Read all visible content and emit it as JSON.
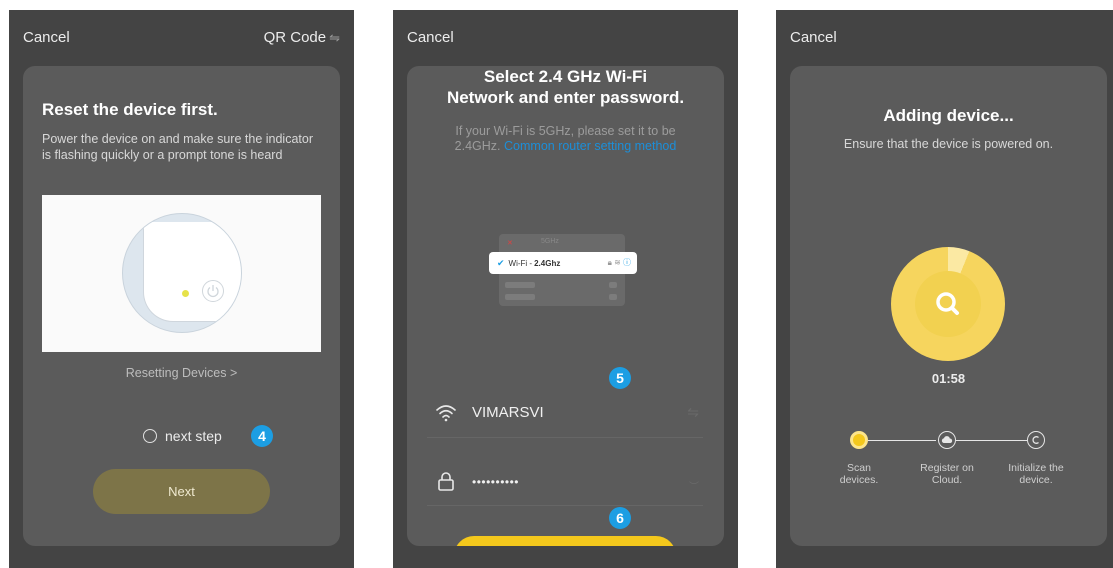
{
  "screens": [
    {
      "top_left": "Cancel",
      "top_right": "QR Code",
      "title": "Reset the device first.",
      "description": "Power the device on and make sure the indicator is flashing quickly or a prompt tone is heard",
      "help_link": "Resetting Devices >",
      "checkbox_label": "next step",
      "badge": "4",
      "button_label": "Next"
    },
    {
      "top_left": "Cancel",
      "title_line1": "Select 2.4 GHz Wi-Fi",
      "title_line2": "Network and enter password.",
      "description": "If your Wi-Fi is 5GHz, please set it to be 2.4GHz.",
      "description_link": "Common router setting method",
      "illus_5g": "5GHz",
      "illus_wifi_label": "Wi-Fi -",
      "illus_wifi_band": "2.4Ghz",
      "badge_top": "5",
      "badge_bottom": "6",
      "network_name": "VIMARSVI",
      "password_mask": "••••••••••"
    },
    {
      "top_left": "Cancel",
      "title": "Adding device...",
      "description": "Ensure that the device is powered on.",
      "timer": "01:58",
      "progress_fraction": 0.06,
      "steps": [
        {
          "line1": "Scan",
          "line2": "devices."
        },
        {
          "line1": "Register on",
          "line2": "Cloud."
        },
        {
          "line1": "Initialize the",
          "line2": "device."
        }
      ],
      "active_step": 0
    }
  ],
  "colors": {
    "screen_bg": "#444444",
    "card_bg": "#5b5b5b",
    "badge_blue": "#1c9ee3",
    "link_blue": "#1c8fd9",
    "next_button": "#7d7448",
    "accent_yellow": "#f4c81c"
  }
}
